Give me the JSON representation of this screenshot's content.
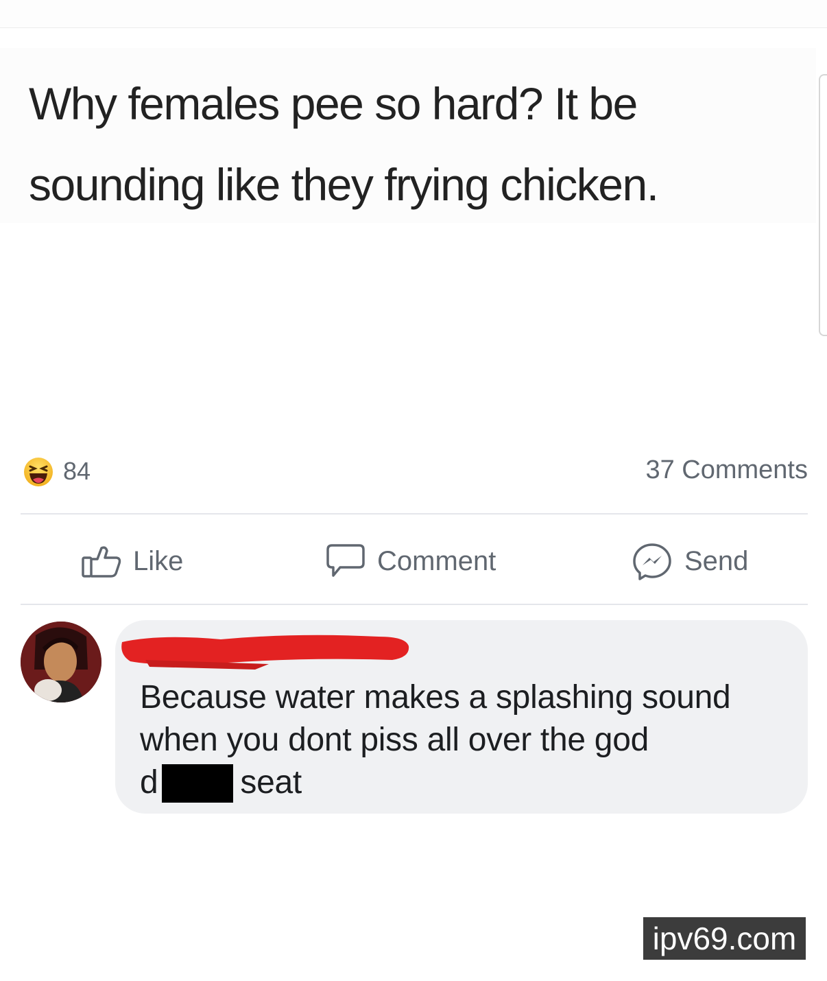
{
  "post": {
    "text": "Why females pee so hard? It be sounding like they frying chicken."
  },
  "reactions": {
    "emoji_icon": "haha-icon",
    "count": "84",
    "comments": "37 Comments"
  },
  "actions": {
    "like": "Like",
    "comment": "Comment",
    "send": "Send"
  },
  "comment": {
    "text_line1": "Because water makes a splashing sound",
    "text_line2": "when you dont piss all over the god",
    "text_start": "d",
    "text_end": "seat"
  },
  "watermark": "ipv69.com",
  "colors": {
    "meta_text": "#606770",
    "bubble": "#f0f1f3",
    "redaction": "#e32222"
  }
}
